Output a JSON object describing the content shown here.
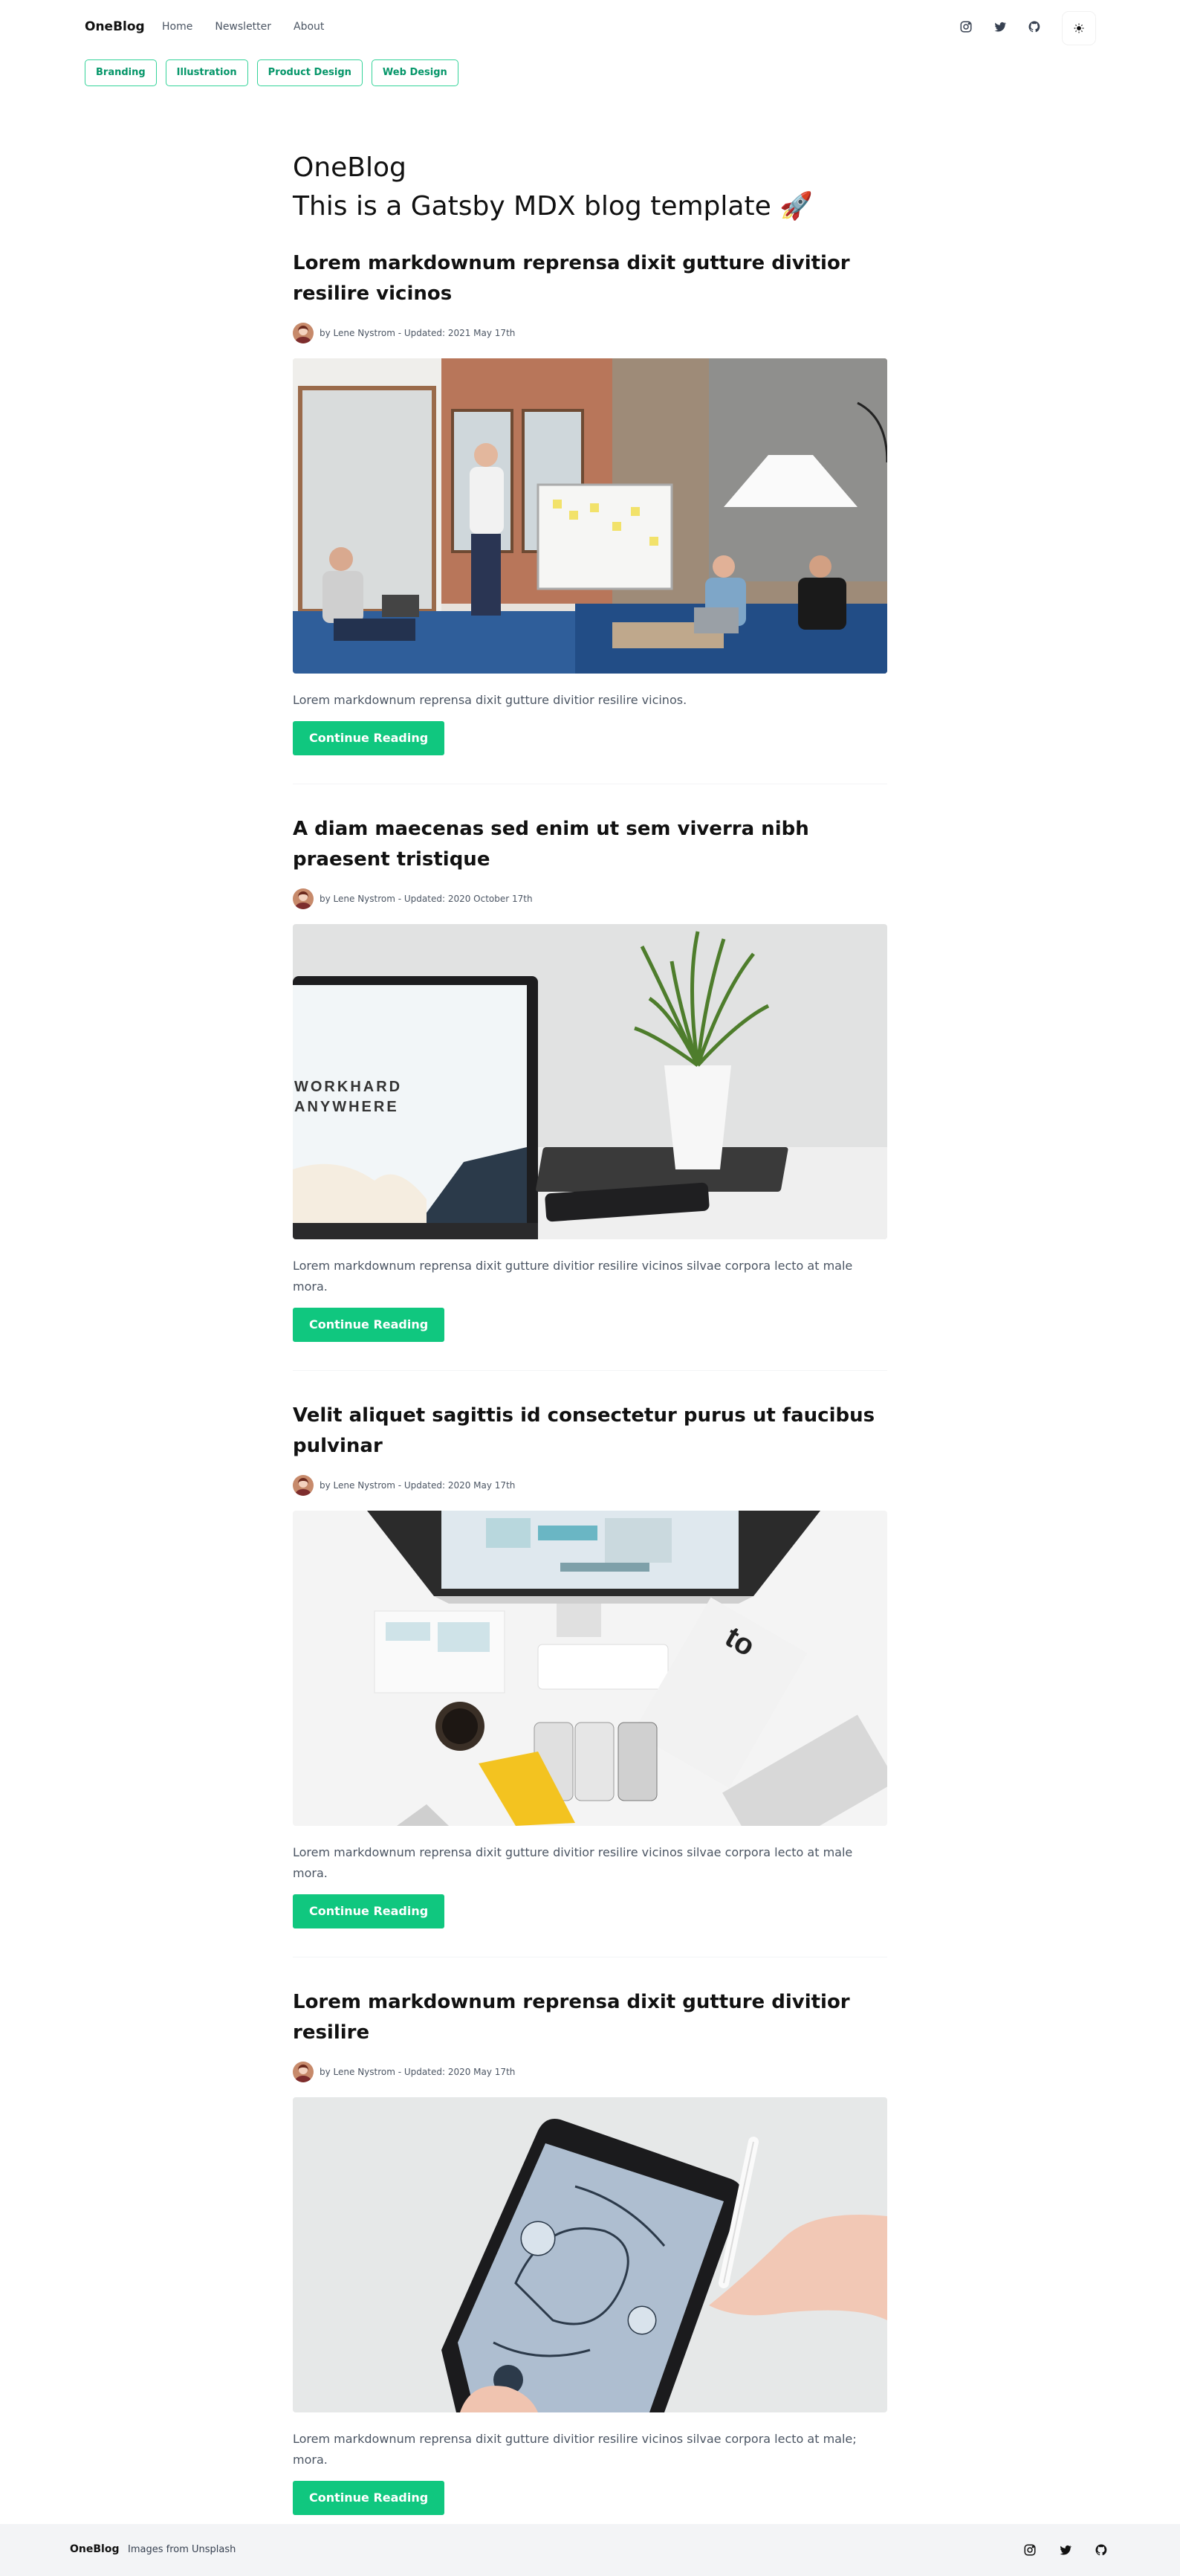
{
  "header": {
    "brand": "OneBlog",
    "nav": [
      "Home",
      "Newsletter",
      "About"
    ],
    "social_icons": [
      "instagram-icon",
      "twitter-icon",
      "github-icon"
    ],
    "theme_icon": "sun-icon"
  },
  "tags": [
    "Branding",
    "Illustration",
    "Product Design",
    "Web Design"
  ],
  "intro": {
    "title": "OneBlog",
    "subtitle": "This is a Gatsby MDX blog template 🚀"
  },
  "posts": [
    {
      "title": "Lorem markdownum reprensa dixit gutture divitior resilire vicinos",
      "meta": "by Lene Nystrom - Updated: 2021 May 17th",
      "excerpt": "Lorem markdownum reprensa dixit gutture divitior resilire vicinos.",
      "button": "Continue Reading",
      "image": "office-team-meeting-photo"
    },
    {
      "title": "A diam maecenas sed enim ut sem viverra nibh praesent tristique",
      "meta": "by Lene Nystrom - Updated: 2020 October 17th",
      "excerpt": "Lorem markdownum reprensa dixit gutture divitior resilire vicinos silvae corpora lecto at male mora.",
      "button": "Continue Reading",
      "image": "laptop-plant-desk-photo",
      "image_text": [
        "WORKHARD",
        "ANYWHERE"
      ]
    },
    {
      "title": "Velit aliquet sagittis id consectetur purus ut faucibus pulvinar",
      "meta": "by Lene Nystrom - Updated: 2020 May 17th",
      "excerpt": "Lorem markdownum reprensa dixit gutture divitior resilire vicinos silvae corpora lecto at male mora.",
      "button": "Continue Reading",
      "image": "design-desk-flatlay-photo"
    },
    {
      "title": "Lorem markdownum reprensa dixit gutture divitior resilire",
      "meta": "by Lene Nystrom - Updated: 2020 May 17th",
      "excerpt": "Lorem markdownum reprensa dixit gutture divitior resilire vicinos silvae corpora lecto at male; mora.",
      "button": "Continue Reading",
      "image": "tablet-drawing-photo"
    }
  ],
  "footer": {
    "brand": "OneBlog",
    "credit": "Images from Unsplash",
    "social_icons": [
      "instagram-icon",
      "twitter-icon",
      "github-icon"
    ]
  },
  "colors": {
    "accent": "#10c77f",
    "tag_border": "#34d399",
    "tag_text": "#059669",
    "footer_bg": "#f3f4f6"
  }
}
